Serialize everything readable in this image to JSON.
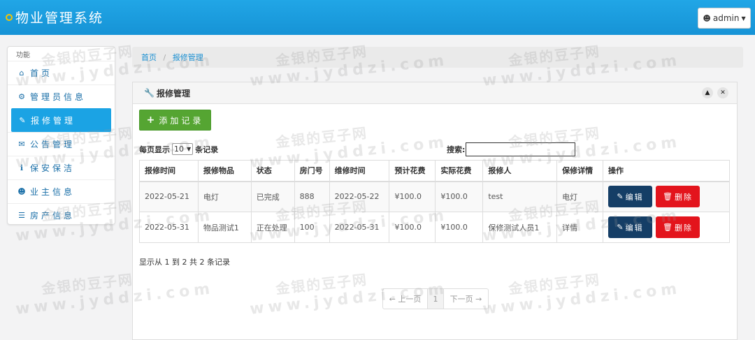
{
  "app": {
    "title": "物业管理系统",
    "user": "admin"
  },
  "sidebar": {
    "header": "功能",
    "items": [
      {
        "label": "首页",
        "icon": "home-icon",
        "glyph": "⌂"
      },
      {
        "label": "管理员信息",
        "icon": "gear-icon",
        "glyph": "⚙"
      },
      {
        "label": "报修管理",
        "icon": "wrench-icon",
        "glyph": "✎"
      },
      {
        "label": "公告管理",
        "icon": "envelope-icon",
        "glyph": "✉"
      },
      {
        "label": "保安保洁",
        "icon": "info-icon",
        "glyph": "ℹ"
      },
      {
        "label": "业主信息",
        "icon": "user-icon",
        "glyph": "☻"
      },
      {
        "label": "房产信息",
        "icon": "list-icon",
        "glyph": "☰"
      }
    ],
    "active_index": 2
  },
  "breadcrumb": {
    "home": "首页",
    "current": "报修管理"
  },
  "panel": {
    "title": "报修管理",
    "add_button": "添加记录",
    "length_prefix": "每页显示",
    "length_value": "10",
    "length_suffix": "条记录",
    "search_label": "搜索:",
    "search_value": ""
  },
  "table": {
    "columns": [
      "报修时间",
      "报修物品",
      "状态",
      "房门号",
      "维修时间",
      "预计花费",
      "实际花费",
      "报修人",
      "保修详情",
      "操作"
    ],
    "rows": [
      [
        "2022-05-21",
        "电灯",
        "已完成",
        "888",
        "2022-05-22",
        "¥100.0",
        "¥100.0",
        "test",
        "电灯"
      ],
      [
        "2022-05-31",
        "物品测试1",
        "正在处理",
        "100",
        "2022-05-31",
        "¥100.0",
        "¥100.0",
        "保修测试人员1",
        "详情"
      ]
    ],
    "edit_label": "编辑",
    "delete_label": "删除"
  },
  "info_text": "显示从 1 到 2 共 2 条记录",
  "pagination": {
    "prev": "← 上一页",
    "page": "1",
    "next": "下一页 →"
  },
  "watermark": {
    "line1": "金银的豆子网",
    "line2": "www.jyddzi.com"
  },
  "colors": {
    "topbar": "#1ba3e4",
    "active": "#1ba3e4",
    "add": "#55a532",
    "edit": "#153e66",
    "delete": "#e3141c"
  }
}
